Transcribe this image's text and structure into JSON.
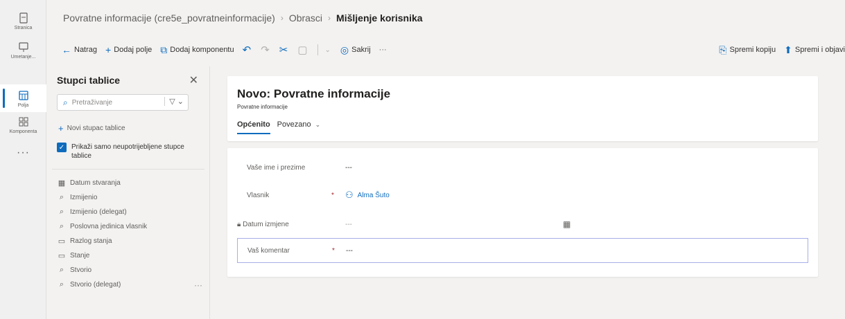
{
  "rail": {
    "items": [
      {
        "label": "Stranica",
        "icon": "page-icon"
      },
      {
        "label": "Umetanje...",
        "icon": "insert-icon"
      },
      {
        "label": "Polja",
        "icon": "fields-icon"
      },
      {
        "label": "Komponenta",
        "icon": "components-icon"
      }
    ],
    "more": "···"
  },
  "breadcrumb": {
    "table": "Povratne informacije (cre5e_povratneinformacije)",
    "section": "Obrasci",
    "current": "Mišljenje korisnika"
  },
  "commands": {
    "back": "Natrag",
    "add_field": "Dodaj polje",
    "add_component": "Dodaj komponentu",
    "hide": "Sakrij",
    "more": "···",
    "save_copy": "Spremi kopiju",
    "save_publish": "Spremi i objavi"
  },
  "panel": {
    "title": "Stupci tablice",
    "close": "✕",
    "search_placeholder": "Pretraživanje",
    "new_column": "Novi stupac tablice",
    "show_unused": "Prikaži samo neupotrijebljene stupce tablice",
    "fields": [
      {
        "label": "Datum stvaranja",
        "icon": "calendar-icon"
      },
      {
        "label": "Izmijenio",
        "icon": "lookup-icon"
      },
      {
        "label": "Izmijenio (delegat)",
        "icon": "lookup-icon"
      },
      {
        "label": "Poslovna jedinica vlasnik",
        "icon": "lookup-icon"
      },
      {
        "label": "Razlog stanja",
        "icon": "choice-icon"
      },
      {
        "label": "Stanje",
        "icon": "choice-icon"
      },
      {
        "label": "Stvorio",
        "icon": "lookup-icon"
      },
      {
        "label": "Stvorio (delegat)",
        "icon": "lookup-icon"
      }
    ]
  },
  "form": {
    "title": "Novo: Povratne informacije",
    "subtitle": "Povratne informacije",
    "tabs": [
      {
        "label": "Općenito"
      },
      {
        "label": "Povezano"
      }
    ],
    "fields": {
      "name_label": "Vaše ime i prezime",
      "name_value": "---",
      "owner_label": "Vlasnik",
      "owner_required": "*",
      "owner_value": "Alma Šuto",
      "modified_label": "Datum izmjene",
      "modified_value": "---",
      "comment_label": "Vaš komentar",
      "comment_required": "*",
      "comment_value": "---"
    }
  },
  "colors": {
    "accent": "#0f6cbd",
    "required": "#a4262c"
  }
}
